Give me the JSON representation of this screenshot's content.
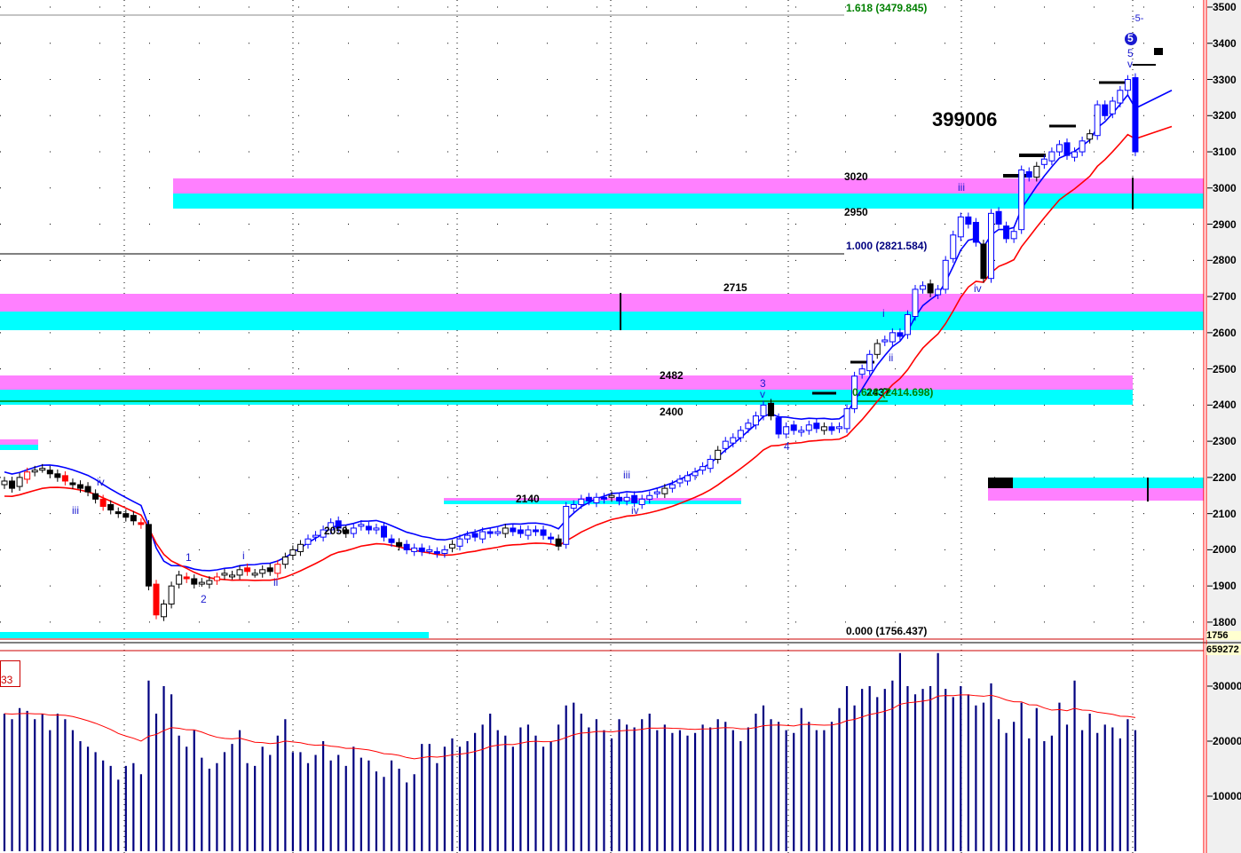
{
  "chart_data": {
    "type": "candlestick",
    "price_axis": {
      "min": 1756,
      "max": 3500,
      "ticks": [
        "3500",
        "3400",
        "3300",
        "3200",
        "3100",
        "3000",
        "2900",
        "2800",
        "2700",
        "2600",
        "2500",
        "2400",
        "2300",
        "2200",
        "2100",
        "2000",
        "1900",
        "1800"
      ],
      "low_box": "1756"
    },
    "volume_axis": {
      "max": 35000,
      "ticks": [
        "30000",
        "20000",
        "10000"
      ],
      "top_box": "659272",
      "period_box": "33"
    },
    "closes": [
      2190,
      2170,
      2200,
      2215,
      2220,
      2225,
      2210,
      2200,
      2190,
      2180,
      2170,
      2160,
      2140,
      2120,
      2110,
      2100,
      2090,
      2080,
      2070,
      1900,
      1820,
      1850,
      1900,
      1930,
      1920,
      1905,
      1910,
      1915,
      1925,
      1935,
      1930,
      1945,
      1940,
      1935,
      1945,
      1940,
      1960,
      1980,
      2000,
      2015,
      2030,
      2040,
      2055,
      2075,
      2060,
      2045,
      2060,
      2070,
      2055,
      2060,
      2035,
      2020,
      2010,
      2000,
      2005,
      1995,
      2000,
      1990,
      2000,
      2015,
      2030,
      2040,
      2035,
      2050,
      2045,
      2050,
      2060,
      2050,
      2045,
      2055,
      2050,
      2040,
      2030,
      2010,
      2120,
      2125,
      2140,
      2135,
      2145,
      2140,
      2150,
      2135,
      2145,
      2130,
      2140,
      2150,
      2160,
      2170,
      2180,
      2195,
      2205,
      2215,
      2230,
      2250,
      2275,
      2300,
      2310,
      2330,
      2350,
      2370,
      2400,
      2370,
      2320,
      2340,
      2330,
      2330,
      2345,
      2335,
      2340,
      2330,
      2340,
      2390,
      2480,
      2500,
      2540,
      2570,
      2580,
      2600,
      2590,
      2650,
      2720,
      2730,
      2710,
      2720,
      2800,
      2870,
      2920,
      2900,
      2850,
      2750,
      2930,
      2900,
      2860,
      2880,
      3050,
      3030,
      3060,
      3080,
      3100,
      3120,
      3090,
      3100,
      3130,
      3150,
      3230,
      3200,
      3240,
      3270,
      3300,
      3100
    ],
    "volumes": [
      25000,
      24000,
      26000,
      25500,
      24000,
      25000,
      22000,
      25000,
      24000,
      22000,
      20000,
      19000,
      18000,
      16500,
      15500,
      13000,
      15500,
      16000,
      14000,
      31000,
      25000,
      30000,
      28500,
      21000,
      19000,
      22000,
      17000,
      15000,
      16000,
      18000,
      19500,
      22000,
      16000,
      15500,
      19000,
      17500,
      21000,
      24000,
      18000,
      18000,
      16000,
      17500,
      20000,
      16500,
      17500,
      15500,
      19000,
      17000,
      16500,
      14500,
      13500,
      16500,
      15000,
      12500,
      14000,
      19500,
      19500,
      16000,
      19000,
      20500,
      19000,
      20000,
      21500,
      23000,
      25000,
      22000,
      21000,
      19000,
      22500,
      23000,
      21000,
      19000,
      20000,
      23000,
      26500,
      27000,
      25000,
      22500,
      24000,
      22000,
      20500,
      24000,
      23000,
      22500,
      24000,
      25000,
      22000,
      23000,
      21500,
      22000,
      21000,
      21500,
      23000,
      22500,
      24000,
      23500,
      22000,
      20000,
      22500,
      25000,
      26500,
      24000,
      23500,
      22000,
      21500,
      26000,
      23500,
      22000,
      22000,
      23500,
      26000,
      30000,
      26500,
      29500,
      30000,
      28000,
      29500,
      31000,
      36000,
      30000,
      28500,
      29500,
      30000,
      36000,
      29500,
      28000,
      30000,
      28500,
      26500,
      27000,
      30500,
      24000,
      21500,
      23500,
      27000,
      20500,
      26000,
      20000,
      21000,
      27000,
      23000,
      31000,
      22000,
      25000,
      21500,
      23000,
      22500,
      20500,
      24000,
      22000
    ]
  },
  "labels": {
    "fib_1618": "1.618 (3479.845)",
    "fib_1000": "1.000 (2821.584)",
    "fib_0618": "0.618 (2414.698)",
    "fib_0000": "0.000 (1756.437)",
    "lvl_3020": "3020",
    "lvl_2950": "2950",
    "lvl_2715": "2715",
    "lvl_2482": "2482",
    "lvl_2400": "2400",
    "lvl_2437": "2437",
    "lvl_2140": "2140",
    "lvl_2050": "2050",
    "big_number": "399006"
  },
  "waves": {
    "w5dash": "-5-",
    "w5circ": "5",
    "w5": "5",
    "wv_top": "v",
    "wiii_top": "iii",
    "wiv_top": "iv",
    "wi": "i",
    "wii": "ii",
    "w3": "3",
    "wv_mid": "v",
    "w4": "4",
    "wiii_mid": "iii",
    "wiv_mid": "iv",
    "wiv_left": "iv",
    "wiii_left": "iii",
    "w1": "1",
    "w2": "2",
    "wi_left": "i",
    "wii_left": "ii"
  },
  "colors": {
    "magenta": "#ff80ff",
    "cyan": "#00ffff",
    "blue": "#0000ff",
    "red": "#ff0000",
    "fib_green": "#008000"
  }
}
